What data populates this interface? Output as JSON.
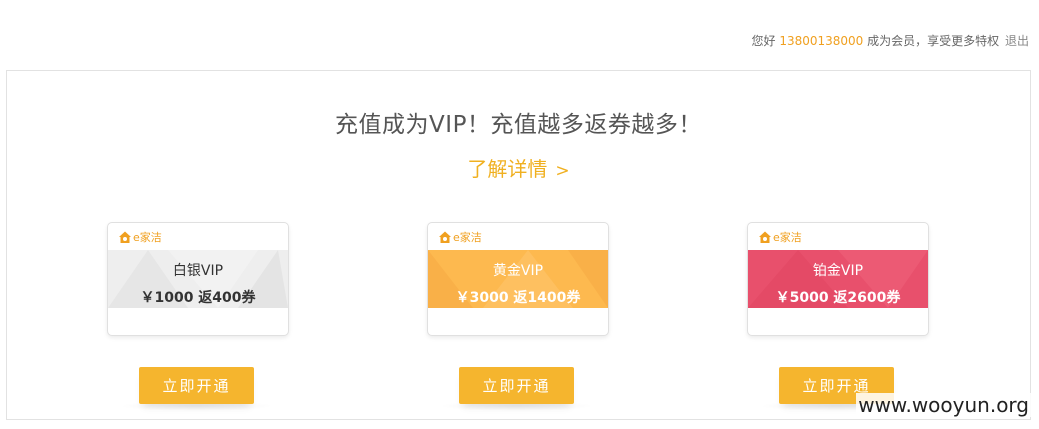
{
  "header": {
    "greeting": "您好",
    "phone": "13800138000",
    "member_text": "成为会员，享受更多特权",
    "logout": "退出"
  },
  "main": {
    "headline": "充值成为VIP！充值越多返券越多！",
    "details_link": "了解详情",
    "details_chevron": ">"
  },
  "brand": {
    "logo_text": "e家洁",
    "color": "#f0a020"
  },
  "cards": [
    {
      "name": "白银VIP",
      "price": "￥1000 返400券",
      "color": "#eeeeee",
      "button": "立即开通"
    },
    {
      "name": "黄金VIP",
      "price": "￥3000 返1400券",
      "color": "#fdb94f",
      "button": "立即开通"
    },
    {
      "name": "铂金VIP",
      "price": "￥5000 返2600券",
      "color": "#e8506c",
      "button": "立即开通"
    }
  ],
  "colors": {
    "accent": "#f5b52e",
    "link": "#f0b020"
  },
  "watermark": "www.wooyun.org"
}
